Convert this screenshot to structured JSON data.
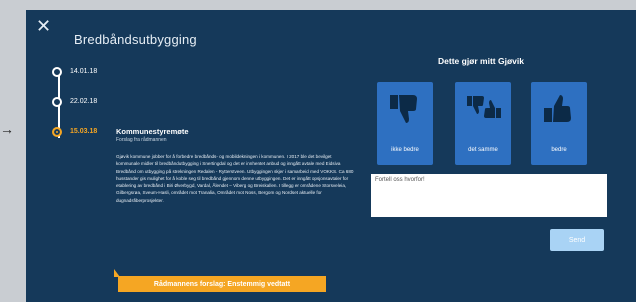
{
  "background": {
    "arrow": "→"
  },
  "modal": {
    "close_icon": "✕",
    "title": "Bredbåndsutbygging"
  },
  "timeline": [
    {
      "date": "14.01.18",
      "active": false
    },
    {
      "date": "22.02.18",
      "active": false
    },
    {
      "date": "15.03.18",
      "active": true
    }
  ],
  "entry": {
    "title": "Kommunestyremøte",
    "subtitle": "Forslag fra rådmannen",
    "body": "Gjøvik kommune jobber for å forbedre bredbånds- og mobildekningen i kommunen. I 2017 ble det bevilget kommunale midler til bredbåndutbygging i Snertingdal og det er innhentet anbud og inngått avtale med Eidsiva Bredbånd om utbygging på strekningen Redalen - Rytterstveen. Utbyggingen skjer i samarbeid med VOKKS. Ca 680 husstander gis mulighet for å koble seg til bredbånd gjennom denne utbyggingen. Det er inngått opsjonsavtaler for etablering av bredbånd i Biri Øverbygd, Vardal, Ålendet – Viberg og Breiskallen. I tillegg er områdene Storsveleia, Gilbergsrøa, Sveum-Hasli, området mot Tranalia, Området mot Noss, Bergom og Nordset aktuelle for dugnadsfiberprosjekter.",
    "banner": "Rådmannens forslag: Enstemmig vedtatt"
  },
  "rating": {
    "title": "Dette gjør mitt Gjøvik",
    "options": [
      {
        "label": "ikke bedre",
        "icon": "thumbs-down-icon"
      },
      {
        "label": "det samme",
        "icon": "thumbs-down-up-icon"
      },
      {
        "label": "bedre",
        "icon": "thumbs-up-icon"
      }
    ]
  },
  "feedback": {
    "placeholder": "Fortell oss hvorfor!",
    "send_label": "Send"
  },
  "colors": {
    "modal_bg": "#15395a",
    "accent": "#f5a623",
    "button_blue": "#2e70c1",
    "send_disabled": "#a9d3f5"
  }
}
